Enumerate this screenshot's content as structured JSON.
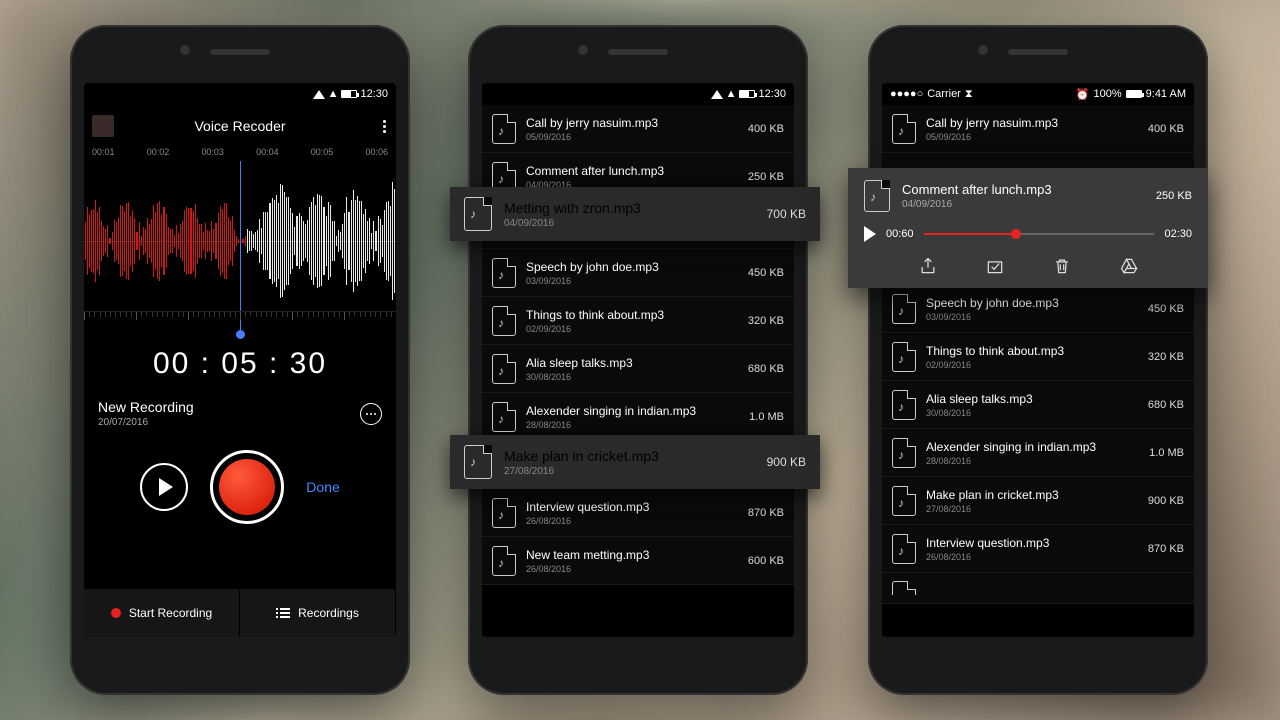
{
  "statusbar": {
    "time": "12:30",
    "ios_carrier": "Carrier",
    "ios_time": "9:41 AM",
    "ios_alarm": "100%"
  },
  "recorder": {
    "title": "Voice Recoder",
    "timemarks": [
      "00:01",
      "00:02",
      "00:03",
      "00:04",
      "00:05",
      "00:06"
    ],
    "elapsed": "00 : 05 : 30",
    "name": "New Recording",
    "date": "20/07/2016",
    "done": "Done",
    "start_label": "Start Recording",
    "recordings_label": "Recordings"
  },
  "files": [
    {
      "name": "Call by jerry nasuim.mp3",
      "date": "05/09/2016",
      "size": "400 KB"
    },
    {
      "name": "Comment after lunch.mp3",
      "date": "04/09/2016",
      "size": "250 KB"
    },
    {
      "name": "Metting with zron.mp3",
      "date": "04/09/2016",
      "size": "700 KB"
    },
    {
      "name": "Speech by john doe.mp3",
      "date": "03/09/2016",
      "size": "450 KB"
    },
    {
      "name": "Things to think about.mp3",
      "date": "02/09/2016",
      "size": "320 KB"
    },
    {
      "name": "Alia sleep talks.mp3",
      "date": "30/08/2016",
      "size": "680 KB"
    },
    {
      "name": "Alexender singing in indian.mp3",
      "date": "28/08/2016",
      "size": "1.0 MB"
    },
    {
      "name": "Make plan in cricket.mp3",
      "date": "27/08/2016",
      "size": "900 KB"
    },
    {
      "name": "Interview question.mp3",
      "date": "26/08/2016",
      "size": "870 KB"
    },
    {
      "name": "New team metting.mp3",
      "date": "26/08/2016",
      "size": "600 KB"
    }
  ],
  "files3_extra_date": "04/09/2016",
  "player": {
    "name": "Comment after lunch.mp3",
    "date": "04/09/2016",
    "size": "250 KB",
    "current": "00:60",
    "total": "02:30",
    "progress_pct": 40
  }
}
